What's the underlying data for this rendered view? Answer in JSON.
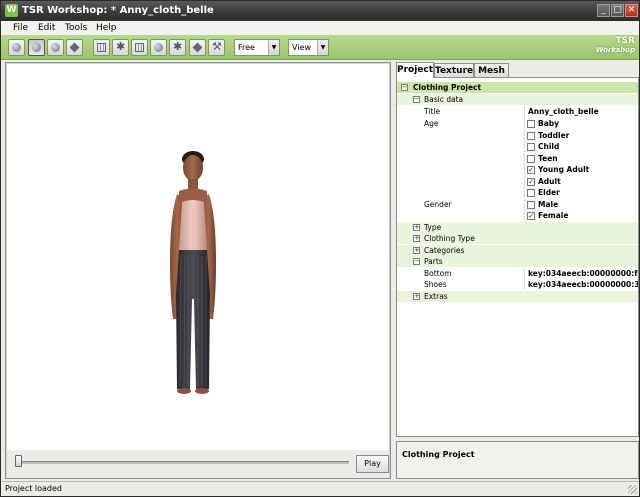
{
  "window": {
    "title": "TSR Workshop: * Anny_cloth_belle",
    "app_icon": "W"
  },
  "menu": [
    "File",
    "Edit",
    "Tools",
    "Help"
  ],
  "toolbar": {
    "mode_combo": "Free",
    "view_combo": "View",
    "brand_line1": "TSR",
    "brand_line2": "Workshop"
  },
  "viewport": {
    "play_label": "Play",
    "playback_progress": 0.0
  },
  "tabs": [
    "Project",
    "Texture",
    "Mesh"
  ],
  "tree": {
    "root": "Clothing Project",
    "basic": "Basic data",
    "title_label": "Title",
    "title_value": "Anny_cloth_belle",
    "age_label": "Age",
    "ages": [
      {
        "label": "Baby",
        "checked": false
      },
      {
        "label": "Toddler",
        "checked": false
      },
      {
        "label": "Child",
        "checked": false
      },
      {
        "label": "Teen",
        "checked": false
      },
      {
        "label": "Young Adult",
        "checked": true
      },
      {
        "label": "Adult",
        "checked": true
      },
      {
        "label": "Elder",
        "checked": false
      }
    ],
    "gender_label": "Gender",
    "genders": [
      {
        "label": "Male",
        "checked": false
      },
      {
        "label": "Female",
        "checked": true
      }
    ],
    "type": "Type",
    "clothing_type": "Clothing Type",
    "categories": "Categories",
    "parts": "Parts",
    "bottom_label": "Bottom",
    "bottom_value": "key:034aeecb:00000000:f...",
    "shoes_label": "Shoes",
    "shoes_value": "key:034aeecb:00000000:3...",
    "extras": "Extras"
  },
  "description": "Clothing Project",
  "status": "Project loaded",
  "colors": {
    "toolbar_green": "#a9ce7d",
    "group_green": "#c9e6a8",
    "sub_green": "#e8f4dc"
  }
}
